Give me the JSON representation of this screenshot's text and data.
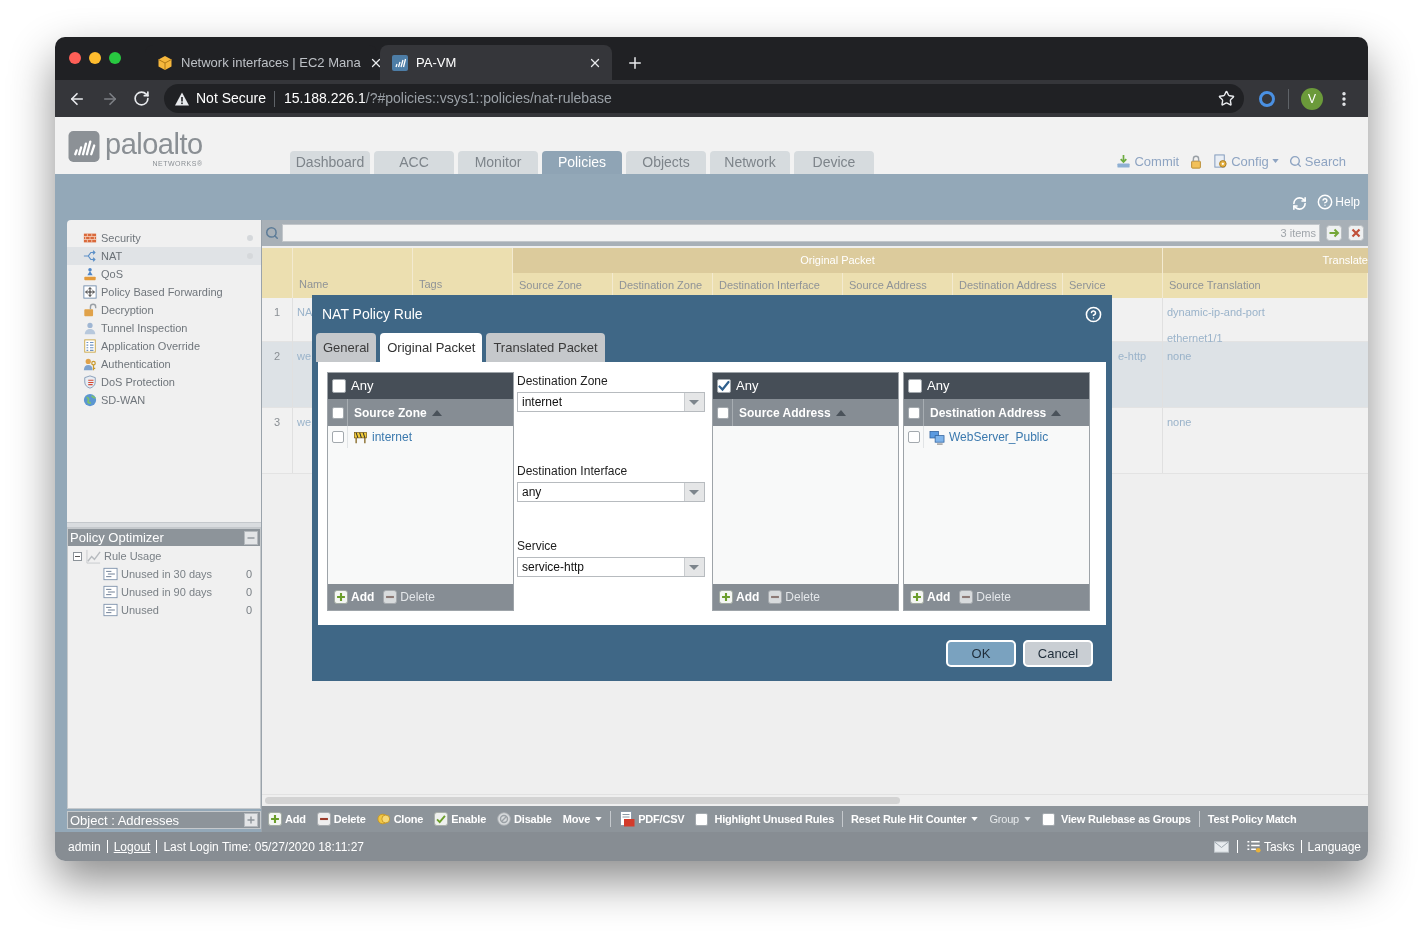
{
  "browser": {
    "tabs": [
      {
        "title": "Network interfaces | EC2 Mana",
        "selected": false
      },
      {
        "title": "PA-VM",
        "selected": true
      }
    ],
    "security": "Not Secure",
    "url_host": "15.188.226.1",
    "url_path": "/?#policies::vsys1::policies/nat-rulebase",
    "profile": "V"
  },
  "header": {
    "logo": "paloalto",
    "logo_subtitle": "NETWORKS®",
    "nav": [
      {
        "label": "Dashboard",
        "selected": false
      },
      {
        "label": "ACC",
        "selected": false
      },
      {
        "label": "Monitor",
        "selected": false
      },
      {
        "label": "Policies",
        "selected": true
      },
      {
        "label": "Objects",
        "selected": false
      },
      {
        "label": "Network",
        "selected": false
      },
      {
        "label": "Device",
        "selected": false
      }
    ],
    "actions": [
      {
        "kind": "commit",
        "label": "Commit"
      },
      {
        "kind": "lock"
      },
      {
        "kind": "config",
        "label": "Config"
      },
      {
        "kind": "search",
        "label": "Search"
      }
    ],
    "help": "Help"
  },
  "sidebar": {
    "rulebases": [
      {
        "label": "Security",
        "selected": false,
        "indicator": true
      },
      {
        "label": "NAT",
        "selected": true,
        "indicator": true
      },
      {
        "label": "QoS",
        "selected": false,
        "indicator": false
      },
      {
        "label": "Policy Based Forwarding",
        "selected": false,
        "indicator": false
      },
      {
        "label": "Decryption",
        "selected": false,
        "indicator": false
      },
      {
        "label": "Tunnel Inspection",
        "selected": false,
        "indicator": false
      },
      {
        "label": "Application Override",
        "selected": false,
        "indicator": false
      },
      {
        "label": "Authentication",
        "selected": false,
        "indicator": false
      },
      {
        "label": "DoS Protection",
        "selected": false,
        "indicator": false
      },
      {
        "label": "SD-WAN",
        "selected": false,
        "indicator": false
      }
    ],
    "policy_optimizer": {
      "title": "Policy Optimizer",
      "expanded": true,
      "tree": [
        {
          "label": "Rule Usage",
          "expanded": true,
          "children": [
            {
              "label": "Unused in 30 days",
              "count": "0"
            },
            {
              "label": "Unused in 90 days",
              "count": "0"
            },
            {
              "label": "Unused",
              "count": "0"
            }
          ]
        }
      ]
    },
    "objects_panel": {
      "title": "Object : Addresses",
      "expanded": false
    }
  },
  "rulebase": {
    "search_count": "3 items",
    "groups": [
      "Original Packet",
      "Translate"
    ],
    "columns": [
      "Name",
      "Tags",
      "Source Zone",
      "Destination Zone",
      "Destination Interface",
      "Source Address",
      "Destination Address",
      "Service",
      "Source Translation"
    ],
    "rows": [
      {
        "number": "1",
        "name": "NA",
        "source_translation": [
          "dynamic-ip-and-port",
          "ethernet1/1"
        ],
        "selected": false
      },
      {
        "number": "2",
        "name": "we",
        "service": "e-http",
        "source_translation": [
          "none"
        ],
        "selected": true
      },
      {
        "number": "3",
        "name": "we",
        "source_translation": [
          "none"
        ],
        "selected": false
      }
    ],
    "toolbar": [
      [
        {
          "kind": "action",
          "label": "Add",
          "disabled": false
        },
        {
          "kind": "action",
          "label": "Delete",
          "disabled": false
        },
        {
          "kind": "action",
          "label": "Clone",
          "disabled": false
        },
        {
          "kind": "action",
          "label": "Enable",
          "disabled": false
        },
        {
          "kind": "action",
          "label": "Disable",
          "disabled": false
        },
        {
          "kind": "menu",
          "label": "Move",
          "disabled": false
        }
      ],
      [
        {
          "kind": "action",
          "label": "PDF/CSV",
          "disabled": false
        },
        {
          "kind": "checkbox",
          "label": "Highlight Unused Rules",
          "checked": false,
          "disabled": false
        }
      ],
      [
        {
          "kind": "menu",
          "label": "Reset Rule Hit Counter",
          "disabled": false
        },
        {
          "kind": "menu",
          "label": "Group",
          "disabled": true
        },
        {
          "kind": "checkbox",
          "label": "View Rulebase as Groups",
          "checked": false,
          "disabled": false
        }
      ],
      [
        {
          "kind": "link",
          "label": "Test Policy Match",
          "disabled": false
        }
      ]
    ]
  },
  "dialog": {
    "title": "NAT Policy Rule",
    "tabs": [
      {
        "label": "General",
        "selected": false
      },
      {
        "label": "Original Packet",
        "selected": true
      },
      {
        "label": "Translated Packet",
        "selected": false
      }
    ],
    "source_zone": {
      "any": {
        "label": "Any",
        "checked": false
      },
      "column": {
        "label": "Source Zone",
        "checked": false,
        "sort_ascending": true
      },
      "items": [
        {
          "kind": "zone",
          "label": "internet",
          "checked": false
        }
      ],
      "actions": [
        {
          "label": "Add",
          "disabled": false
        },
        {
          "label": "Delete",
          "disabled": true
        }
      ]
    },
    "fields": [
      {
        "label": "Destination Zone",
        "value": "internet"
      },
      {
        "label": "Destination Interface",
        "value": "any"
      },
      {
        "label": "Service",
        "value": "service-http"
      }
    ],
    "source_address": {
      "any": {
        "label": "Any",
        "checked": true
      },
      "column": {
        "label": "Source Address",
        "checked": false,
        "sort_ascending": true
      },
      "actions": [
        {
          "label": "Add",
          "disabled": false
        },
        {
          "label": "Delete",
          "disabled": true
        }
      ]
    },
    "destination_address": {
      "any": {
        "label": "Any",
        "checked": false
      },
      "column": {
        "label": "Destination Address",
        "checked": false,
        "sort_ascending": true
      },
      "items": [
        {
          "kind": "address",
          "label": "WebServer_Public",
          "checked": false
        }
      ],
      "actions": [
        {
          "label": "Add",
          "disabled": false
        },
        {
          "label": "Delete",
          "disabled": true
        }
      ]
    },
    "buttons": [
      {
        "label": "OK",
        "kind": "primary"
      },
      {
        "label": "Cancel",
        "kind": "secondary"
      }
    ]
  },
  "status_bar": {
    "user": "admin",
    "logout": "Logout",
    "last_login": "Last Login Time: 05/27/2020 18:11:27",
    "tasks": "Tasks",
    "language": "Language"
  }
}
